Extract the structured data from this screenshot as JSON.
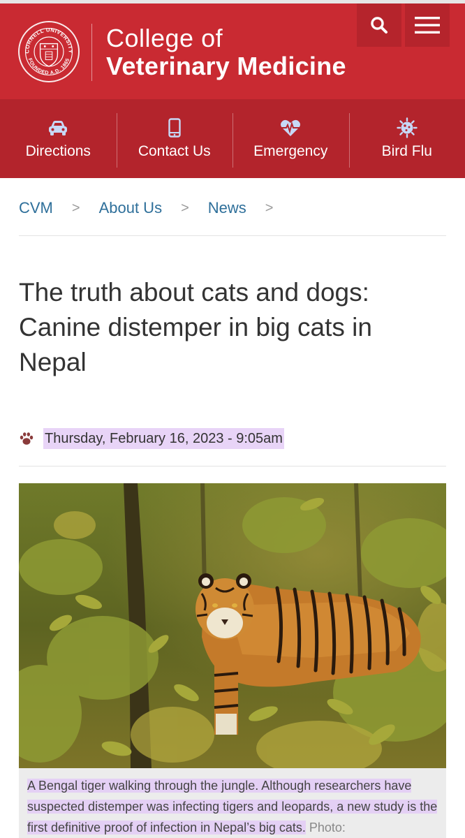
{
  "header": {
    "title_line1": "College of",
    "title_line2": "Veterinary Medicine",
    "seal_text_top": "CORNELL UNIVERSITY",
    "seal_text_bottom": "FOUNDED A.D. 1865",
    "search_icon": "search-icon",
    "menu_icon": "hamburger-menu-icon",
    "colors": {
      "primary": "#c92a32",
      "secondary": "#b3242c"
    }
  },
  "quicknav": {
    "items": [
      {
        "label": "Directions",
        "icon": "car-icon"
      },
      {
        "label": "Contact Us",
        "icon": "phone-icon"
      },
      {
        "label": "Emergency",
        "icon": "heartbeat-icon"
      },
      {
        "label": "Bird Flu",
        "icon": "virus-icon"
      }
    ]
  },
  "breadcrumb": {
    "items": [
      "CVM",
      "About Us",
      "News"
    ],
    "separator": ">"
  },
  "article": {
    "title": "The truth about cats and dogs: Canine distemper in big cats in Nepal",
    "date": "Thursday, February 16, 2023 - 9:05am",
    "date_icon": "paw-icon",
    "image_alt": "Bengal tiger in jungle",
    "caption_text": "A Bengal tiger walking through the jungle. Although researchers have suspected distemper was infecting tigers and leopards, a new study is the first definitive proof of infection in Nepal’s big cats.",
    "caption_credit": "Photo:",
    "highlight_color": "#e8d4f7"
  }
}
